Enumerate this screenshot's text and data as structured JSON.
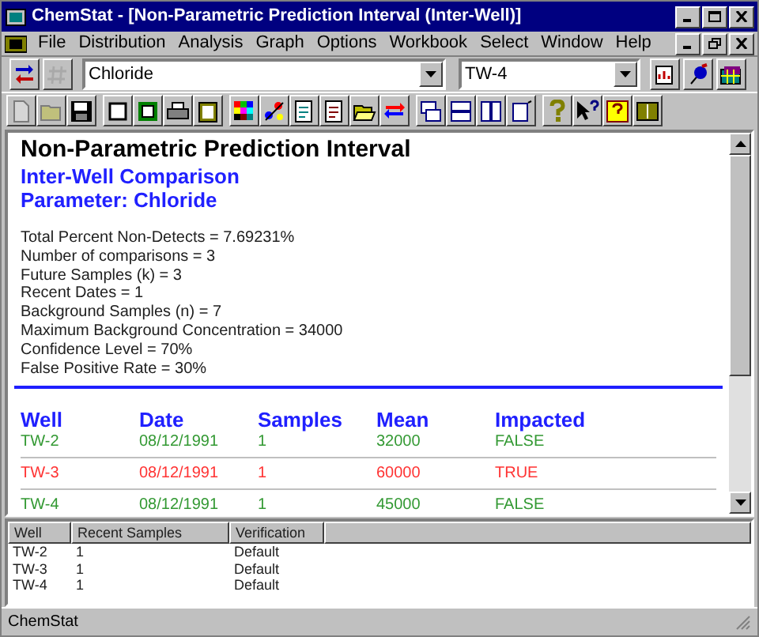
{
  "window": {
    "title": "ChemStat - [Non-Parametric Prediction Interval (Inter-Well)]"
  },
  "menu": [
    "File",
    "Distribution",
    "Analysis",
    "Graph",
    "Options",
    "Workbook",
    "Select",
    "Window",
    "Help"
  ],
  "toolbar": {
    "left_buttons": [
      {
        "disabled": false
      },
      {
        "disabled": true
      }
    ],
    "parameter_combo": {
      "value": "Chloride"
    },
    "well_combo": {
      "value": "TW-4"
    },
    "buttons": [
      {
        "disabled": true
      },
      {
        "disabled": true
      },
      {
        "disabled": false
      },
      {
        "disabled": false
      },
      {
        "disabled": false
      },
      {
        "disabled": false
      },
      {
        "disabled": false
      },
      {
        "disabled": false
      },
      {
        "disabled": false
      },
      {
        "disabled": false
      },
      {
        "disabled": false
      },
      {
        "disabled": false
      },
      {
        "disabled": false
      },
      {
        "disabled": false
      },
      {
        "disabled": false
      },
      {
        "disabled": false
      },
      {
        "disabled": false
      },
      {
        "disabled": false
      },
      {
        "disabled": false
      },
      {
        "disabled": false
      },
      {
        "disabled": false
      }
    ]
  },
  "report": {
    "title": "Non-Parametric Prediction Interval",
    "subtitle": "Inter-Well Comparison",
    "parameter": "Parameter: Chloride",
    "stats": [
      "Total Percent Non-Detects = 7.69231%",
      "Number of comparisons = 3",
      "Future Samples (k) = 3",
      "Recent Dates = 1",
      "Background Samples (n) = 7",
      "Maximum Background Concentration = 34000",
      "Confidence Level = 70%",
      "False Positive Rate = 30%"
    ],
    "table": {
      "columns": [
        "Well",
        "Date",
        "Samples",
        "Mean",
        "Impacted"
      ],
      "rows": [
        {
          "cells": [
            "TW-2",
            "08/12/1991",
            "1",
            "32000",
            "FALSE"
          ],
          "color": "#339933"
        },
        {
          "cells": [
            "TW-3",
            "08/12/1991",
            "1",
            "60000",
            "TRUE"
          ],
          "color": "#ff3333"
        },
        {
          "cells": [
            "TW-4",
            "08/12/1991",
            "1",
            "45000",
            "FALSE"
          ],
          "color": "#339933"
        }
      ]
    }
  },
  "grid": {
    "columns": [
      "Well",
      "Recent Samples",
      "Verification"
    ],
    "rows": [
      [
        "TW-2",
        "1",
        "Default"
      ],
      [
        "TW-3",
        "1",
        "Default"
      ],
      [
        "TW-4",
        "1",
        "Default"
      ]
    ]
  },
  "status_bar": "ChemStat"
}
